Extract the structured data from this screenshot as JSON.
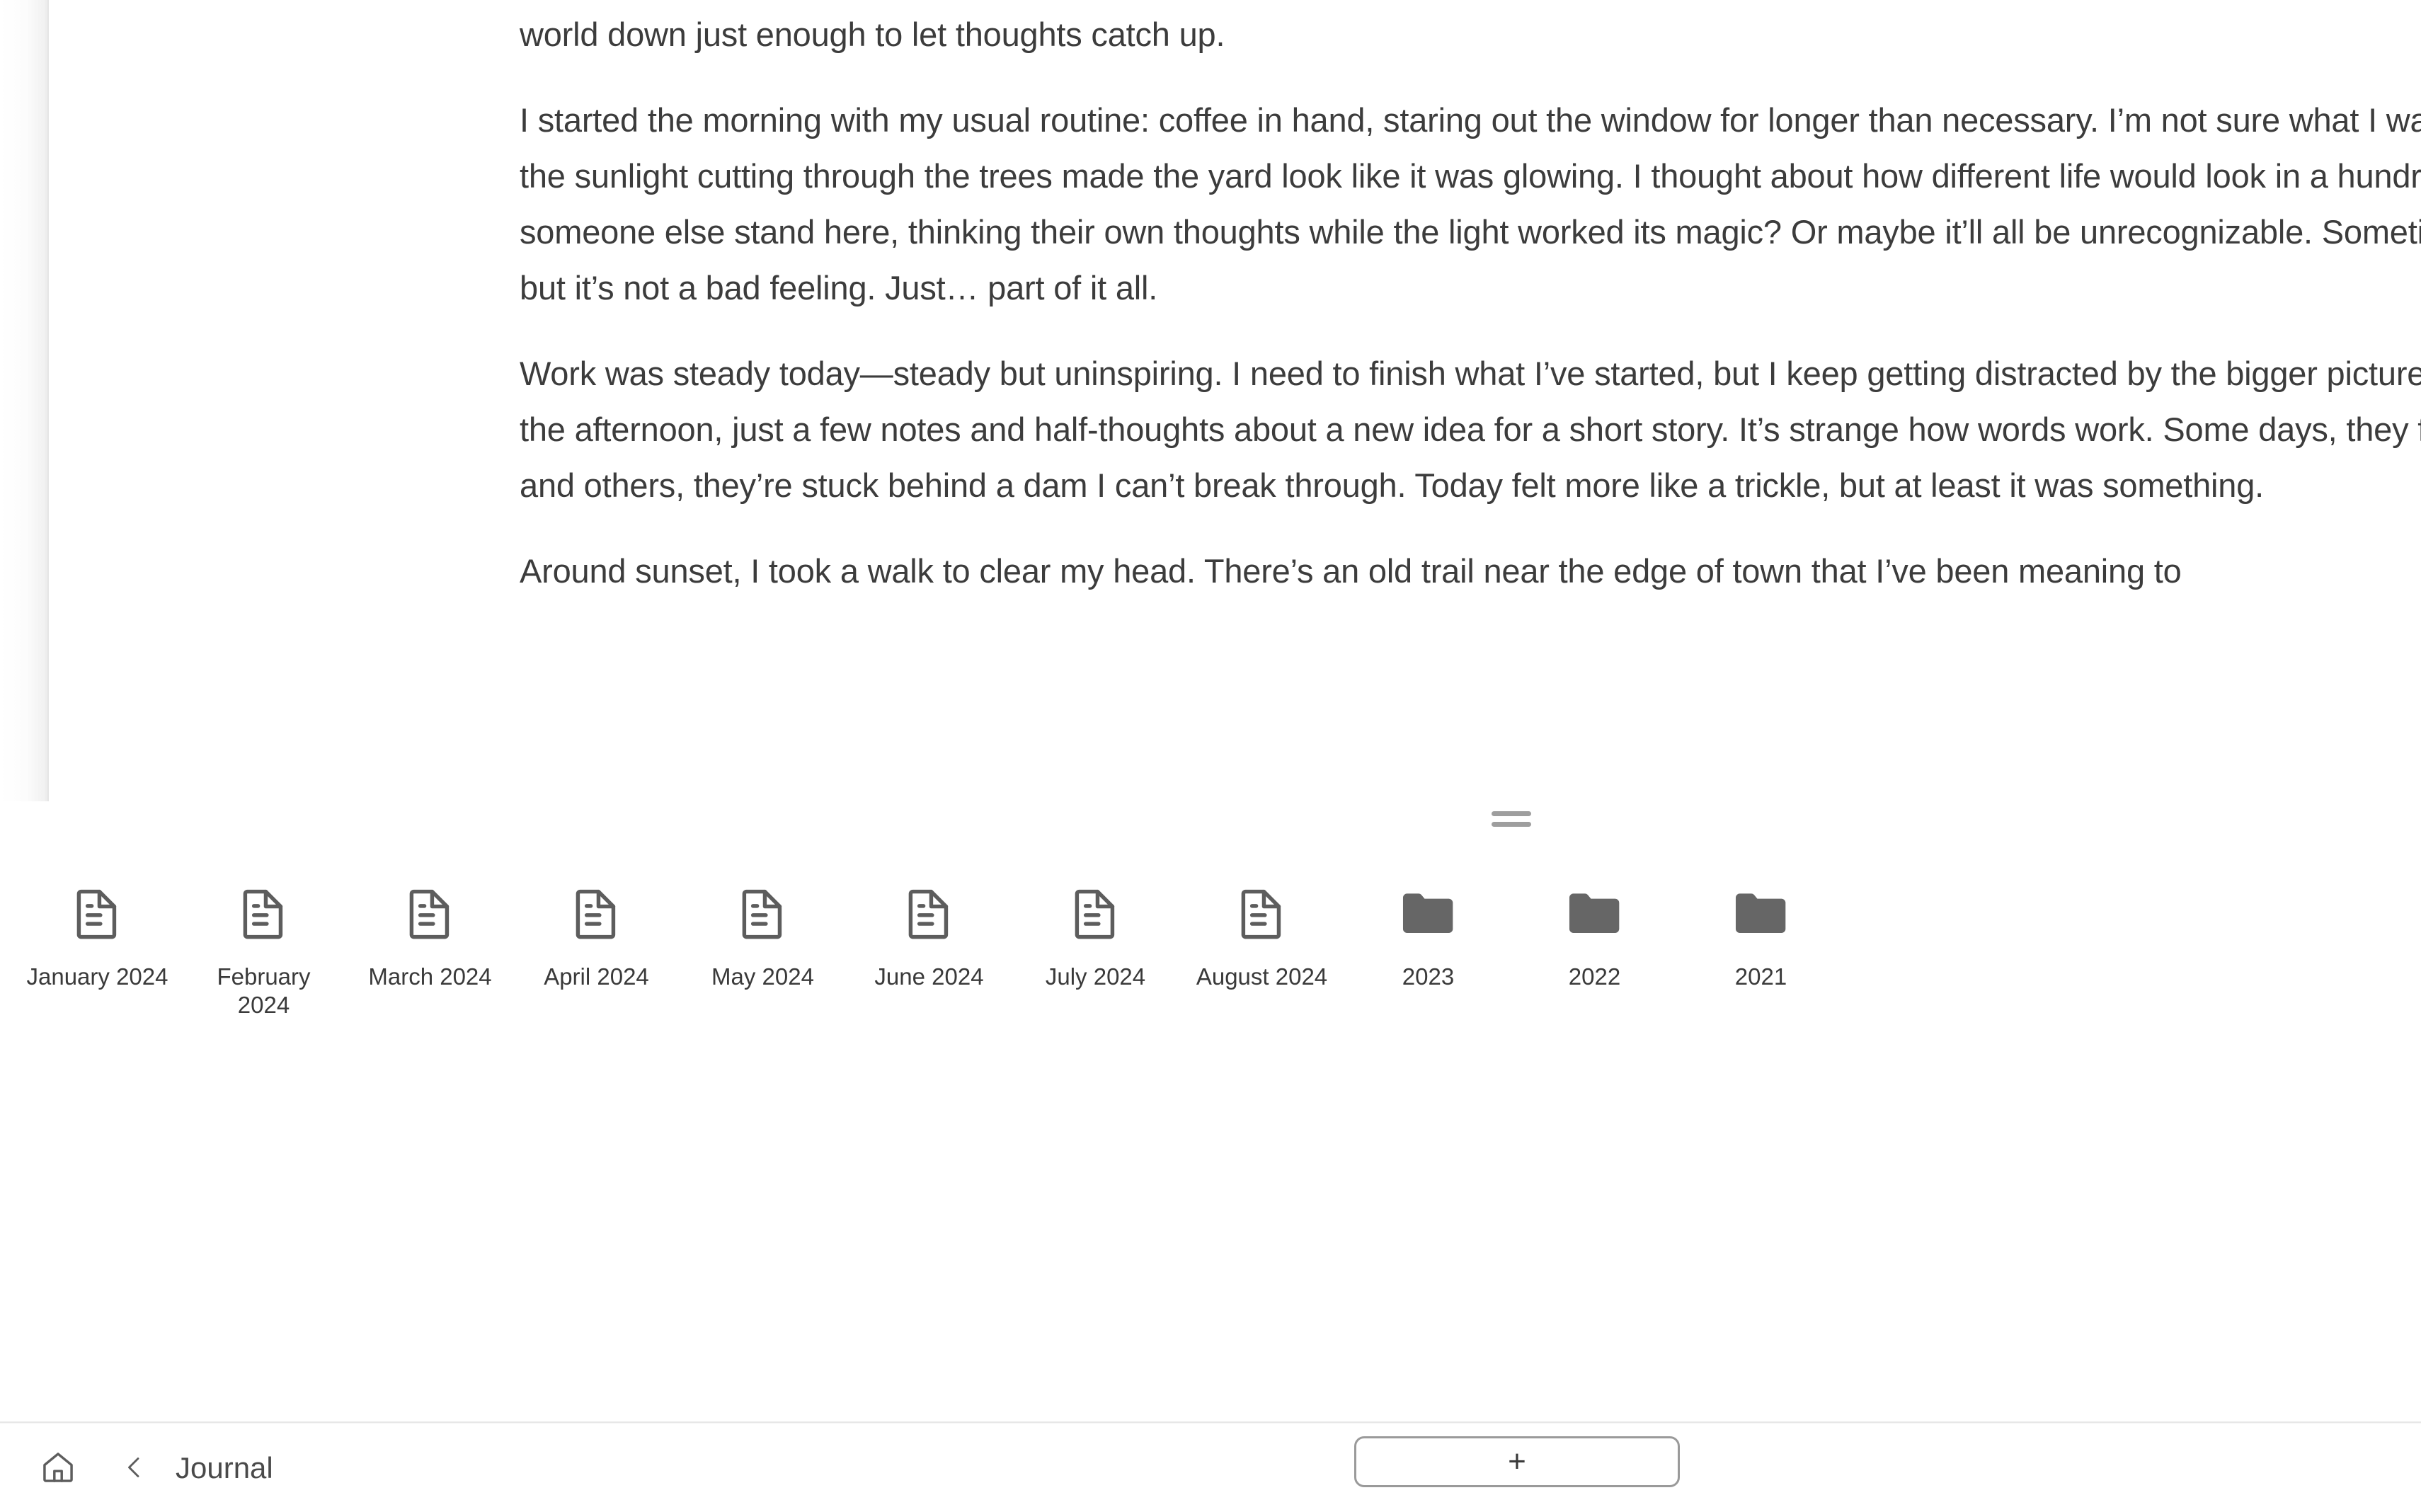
{
  "document": {
    "paragraphs": [
      "this morning, the kind of day where everything seems to drag, but I found a bit of peace in it too. There’s something about summer that slows the world down just enough to let thoughts catch up.",
      "I started the morning with my usual routine: coffee in hand, staring out the window for longer than necessary. I’m not sure what I was looking for, but the sunlight cutting through the trees made the yard look like it was glowing. I thought about how different life would look in a hundred years—would someone else stand here, thinking their own thoughts while the light worked its magic? Or maybe it’ll all be unrecognizable. Sometimes I feel small, but it’s not a bad feeling. Just… part of it all.",
      "Work was steady today—steady but uninspiring. I need to finish what I’ve started, but I keep getting distracted by the bigger picture. I wrote a little in the afternoon, just a few notes and half-thoughts about a new idea for a short story. It’s strange how words work. Some days, they flow like a river, and others, they’re stuck behind a dam I can’t break through. Today felt more like a trickle, but at least it was something.",
      "Around sunset, I took a walk to clear my head. There’s an old trail near the edge of town that I’ve been meaning to"
    ]
  },
  "panel": {
    "drag_handle_icon": "drag-handle-icon",
    "items": [
      {
        "label": "January 2024",
        "type": "file",
        "icon": "document-icon"
      },
      {
        "label": "February 2024",
        "type": "file",
        "icon": "document-icon"
      },
      {
        "label": "March 2024",
        "type": "file",
        "icon": "document-icon"
      },
      {
        "label": "April 2024",
        "type": "file",
        "icon": "document-icon"
      },
      {
        "label": "May 2024",
        "type": "file",
        "icon": "document-icon"
      },
      {
        "label": "June 2024",
        "type": "file",
        "icon": "document-icon"
      },
      {
        "label": "July 2024",
        "type": "file",
        "icon": "document-icon"
      },
      {
        "label": "August 2024",
        "type": "file",
        "icon": "document-icon"
      },
      {
        "label": "2023",
        "type": "folder",
        "icon": "folder-icon"
      },
      {
        "label": "2022",
        "type": "folder",
        "icon": "folder-icon"
      },
      {
        "label": "2021",
        "type": "folder",
        "icon": "folder-icon"
      }
    ]
  },
  "bottom_bar": {
    "home_icon": "home-icon",
    "back_icon": "chevron-left-icon",
    "title": "Journal",
    "add_label": "+"
  },
  "colors": {
    "text_body": "#3c3c3c",
    "text_label": "#3a3a3a",
    "icon_outline": "#5d5d5d",
    "folder_fill": "#666666",
    "handle": "#9e9e9e",
    "button_border": "#9a9a9a",
    "background": "#ffffff"
  }
}
